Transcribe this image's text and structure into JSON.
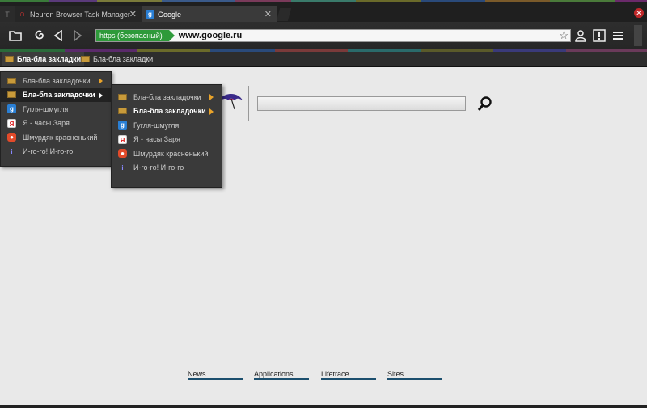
{
  "tabs": [
    {
      "label": "T",
      "icon": "small-tab-icon"
    },
    {
      "label": "Neuron Browser Task Manager",
      "icon": "neuron-icon"
    },
    {
      "label": "Google",
      "icon": "google-icon",
      "active": true
    }
  ],
  "toolbar": {
    "https_label": "https (безопасный)",
    "url": "www.google.ru"
  },
  "bookmarks_bar": [
    {
      "label": "Бла-бла закладки"
    },
    {
      "label": "Бла-бла закладки"
    }
  ],
  "menu1": [
    {
      "label": "Бла-бла закладочки",
      "icon": "folder-icon",
      "submenu": true
    },
    {
      "label": "Бла-бла закладочки",
      "icon": "folder-icon",
      "submenu": true
    },
    {
      "label": "Гугля-шмугля",
      "icon": "google-icon"
    },
    {
      "label": "Я - часы Заря",
      "icon": "yandex-icon"
    },
    {
      "label": "Шмурдяк красненький",
      "icon": "red-site-icon"
    },
    {
      "label": "И-го-го! И-го-го",
      "icon": "info-icon"
    }
  ],
  "menu2": [
    {
      "label": "Бла-бла закладочки",
      "icon": "folder-icon",
      "submenu": true
    },
    {
      "label": "Бла-бла закладочки",
      "icon": "folder-icon",
      "submenu": true
    },
    {
      "label": "Гугля-шмугля",
      "icon": "google-icon"
    },
    {
      "label": "Я - часы Заря",
      "icon": "yandex-icon"
    },
    {
      "label": "Шмурдяк красненький",
      "icon": "red-site-icon"
    },
    {
      "label": "И-го-го! И-го-го",
      "icon": "info-icon"
    }
  ],
  "footer_links": [
    "News",
    "Applications",
    "Lifetrace",
    "Sites"
  ],
  "colors": {
    "https_green": "#2e9a3a",
    "accent_orange": "#e9a32a",
    "footer_bar": "#1c4f6e",
    "close_red": "#c0282a"
  }
}
